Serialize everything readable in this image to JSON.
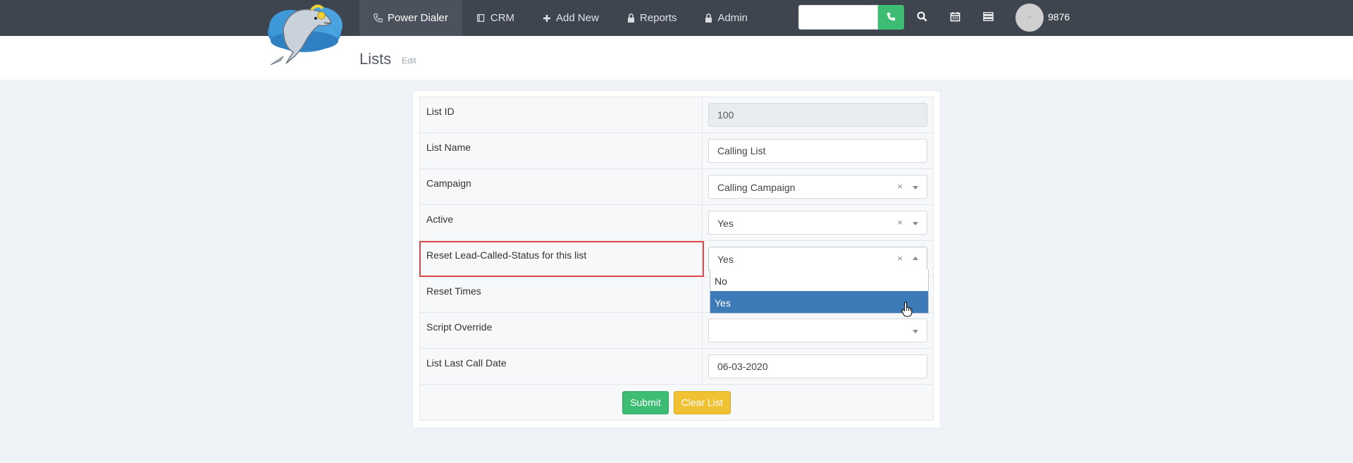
{
  "nav": {
    "items": [
      {
        "label": "Power Dialer",
        "icon": "phone-icon",
        "active": true
      },
      {
        "label": "CRM",
        "icon": "book-icon",
        "active": false
      },
      {
        "label": "Add New",
        "icon": "plus-icon",
        "active": false
      },
      {
        "label": "Reports",
        "icon": "lock-icon",
        "active": false
      },
      {
        "label": "Admin",
        "icon": "lock-icon",
        "active": false
      }
    ]
  },
  "topbar": {
    "search_value": "",
    "user_ext": "9876",
    "icons": [
      "phone-icon",
      "search-icon",
      "calendar-icon",
      "list-icon"
    ]
  },
  "header": {
    "title": "Lists",
    "edit_label": "Edit"
  },
  "form": {
    "list_id": {
      "label": "List ID",
      "value": "100"
    },
    "list_name": {
      "label": "List Name",
      "value": "Calling List"
    },
    "campaign": {
      "label": "Campaign",
      "value": "Calling Campaign",
      "clear": "×"
    },
    "active": {
      "label": "Active",
      "value": "Yes",
      "clear": "×"
    },
    "reset_status": {
      "label": "Reset Lead-Called-Status for this list",
      "value": "Yes",
      "clear": "×",
      "options": [
        "No",
        "Yes"
      ],
      "highlighted": "Yes"
    },
    "reset_times": {
      "label": "Reset Times"
    },
    "script_override": {
      "label": "Script Override",
      "value": ""
    },
    "last_call_date": {
      "label": "List Last Call Date",
      "value": "06-03-2020"
    },
    "submit_label": "Submit",
    "clear_label": "Clear List"
  },
  "colors": {
    "topbar": "#3f454f",
    "submit": "#3dbd73",
    "clear": "#f0c233",
    "highlight_option": "#3d7ab8",
    "annotation_box": "#e04848"
  }
}
